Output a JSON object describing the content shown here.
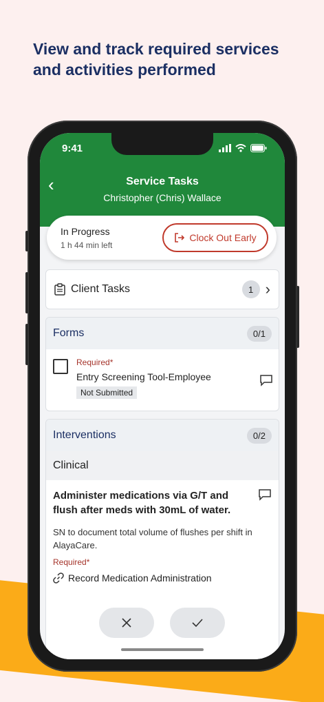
{
  "headline": "View and track required services and activities performed",
  "status_bar": {
    "time": "9:41"
  },
  "header": {
    "title": "Service Tasks",
    "subtitle": "Christopher (Chris) Wallace"
  },
  "progress": {
    "label": "In Progress",
    "time_left": "1 h 44 min left",
    "clock_out_label": "Clock Out Early"
  },
  "client_tasks": {
    "label": "Client Tasks",
    "count": "1"
  },
  "forms": {
    "title": "Forms",
    "count": "0/1",
    "items": [
      {
        "required": "Required*",
        "name": "Entry Screening Tool-Employee",
        "status": "Not Submitted"
      }
    ]
  },
  "interventions": {
    "title": "Interventions",
    "count": "0/2",
    "category": "Clinical",
    "items": [
      {
        "title": "Administer medications via G/T and flush after meds with 30mL of water.",
        "description": "SN to document total volume of flushes per shift in AlayaCare.",
        "required": "Required*",
        "link": "Record Medication Administration"
      }
    ]
  },
  "colors": {
    "header_green": "#20883b",
    "accent_red": "#c0392b",
    "navy": "#1b2f63",
    "orange": "#fbab18"
  }
}
